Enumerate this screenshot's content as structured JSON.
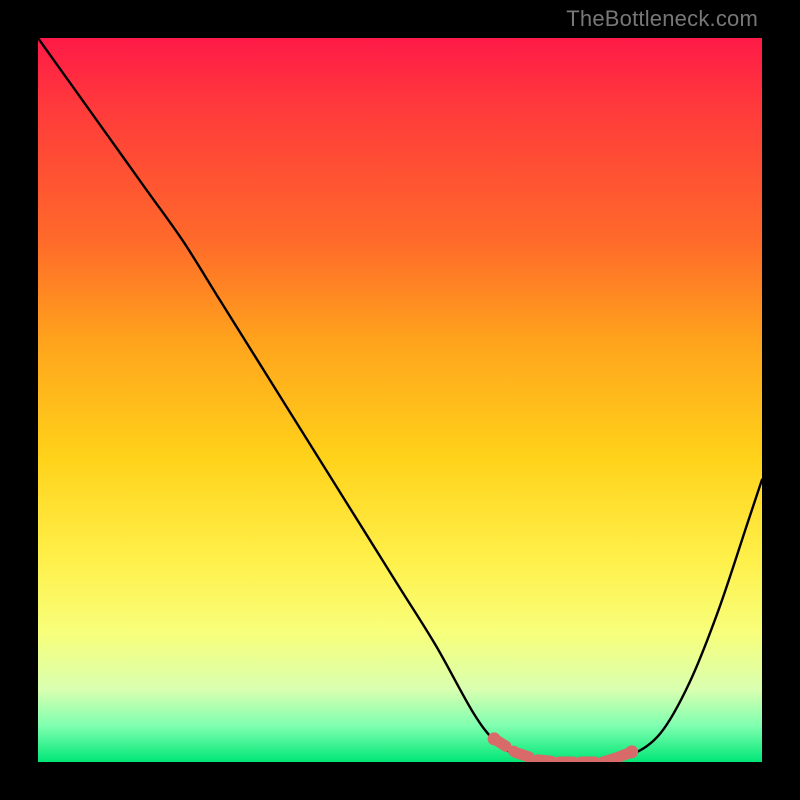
{
  "watermark": "TheBottleneck.com",
  "colors": {
    "curve": "#000000",
    "marker": "#d96a6a",
    "background_top": "#ff1a47",
    "background_bottom": "#00e676",
    "frame": "#000000"
  },
  "chart_data": {
    "type": "line",
    "title": "",
    "xlabel": "",
    "ylabel": "",
    "xlim": [
      0,
      100
    ],
    "ylim": [
      0,
      100
    ],
    "grid": false,
    "legend": false,
    "series": [
      {
        "name": "bottleneck-curve",
        "x": [
          0,
          5,
          10,
          15,
          20,
          25,
          30,
          35,
          40,
          45,
          50,
          55,
          60,
          63,
          66,
          70,
          74,
          78,
          82,
          86,
          90,
          94,
          98,
          100
        ],
        "values": [
          100,
          93,
          86,
          79,
          72,
          64,
          56,
          48,
          40,
          32,
          24,
          16,
          7,
          3,
          1,
          0,
          0,
          0,
          1,
          4,
          11,
          21,
          33,
          39
        ]
      }
    ],
    "markers": {
      "name": "optimal-range-markers",
      "x": [
        63,
        66,
        69,
        72,
        75,
        78,
        80,
        82
      ],
      "values": [
        3.2,
        1.3,
        0.3,
        0,
        0,
        0,
        0.6,
        1.4
      ]
    }
  }
}
